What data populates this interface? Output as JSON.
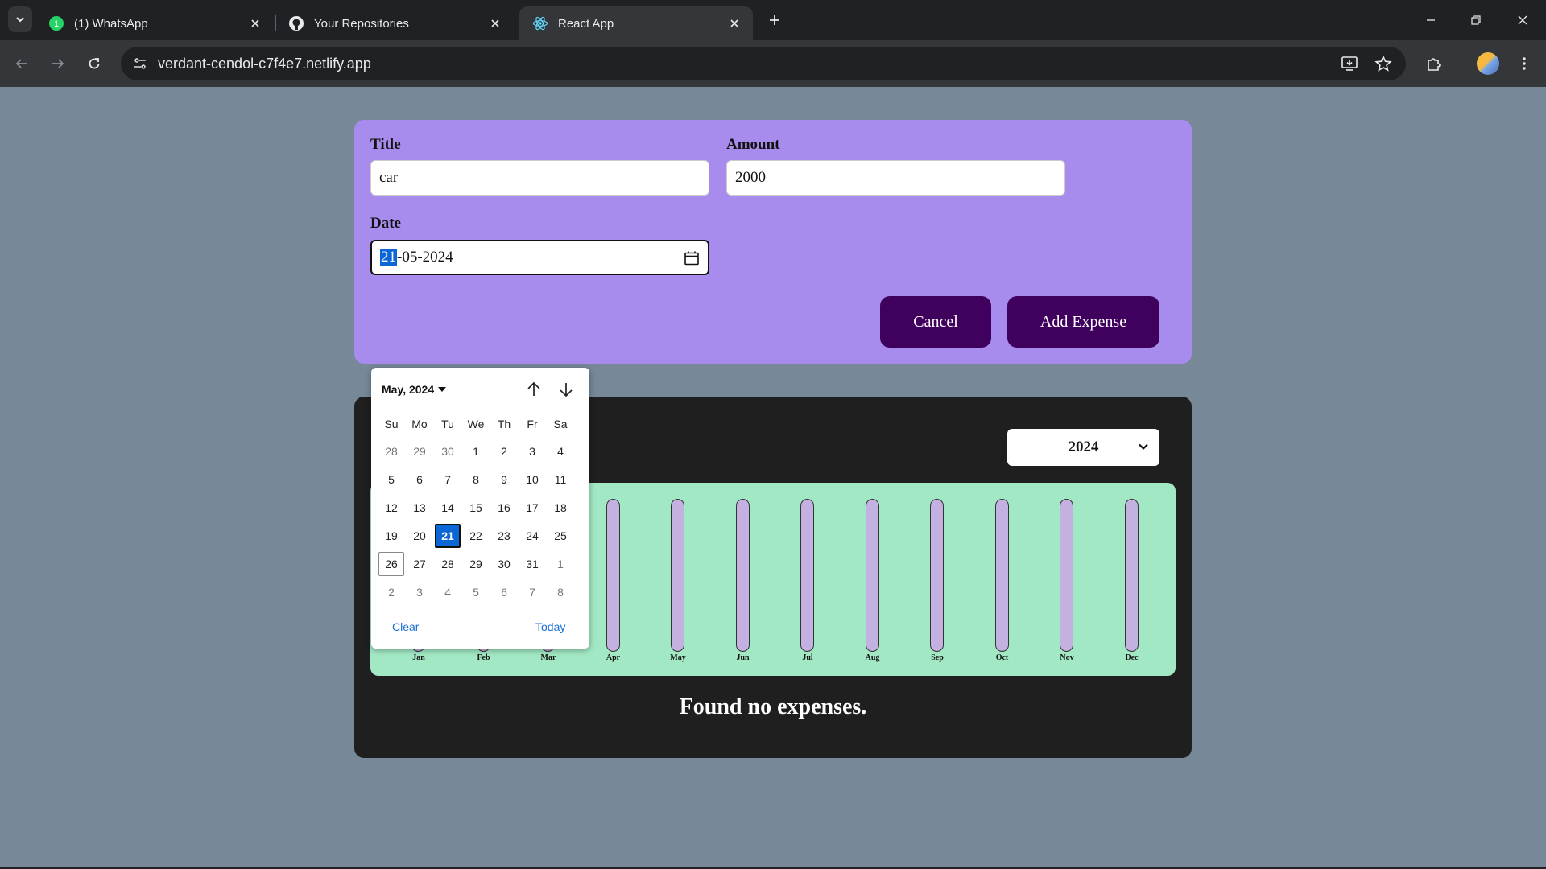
{
  "browser": {
    "tabs": [
      {
        "title": "(1) WhatsApp",
        "icon": "whatsapp-icon"
      },
      {
        "title": "Your Repositories",
        "icon": "github-icon"
      },
      {
        "title": "React App",
        "icon": "react-icon"
      }
    ],
    "url": "verdant-cendol-c7f4e7.netlify.app"
  },
  "form": {
    "title_label": "Title",
    "title_value": "car",
    "amount_label": "Amount",
    "amount_value": "2000",
    "date_label": "Date",
    "date_day": "21",
    "date_rest": "-05-2024",
    "cancel_label": "Cancel",
    "add_label": "Add Expense"
  },
  "datepicker": {
    "month_label": "May, 2024",
    "weekdays": [
      "Su",
      "Mo",
      "Tu",
      "We",
      "Th",
      "Fr",
      "Sa"
    ],
    "weeks": [
      [
        "28",
        "29",
        "30",
        "1",
        "2",
        "3",
        "4"
      ],
      [
        "5",
        "6",
        "7",
        "8",
        "9",
        "10",
        "11"
      ],
      [
        "12",
        "13",
        "14",
        "15",
        "16",
        "17",
        "18"
      ],
      [
        "19",
        "20",
        "21",
        "22",
        "23",
        "24",
        "25"
      ],
      [
        "26",
        "27",
        "28",
        "29",
        "30",
        "31",
        "1"
      ],
      [
        "2",
        "3",
        "4",
        "5",
        "6",
        "7",
        "8"
      ]
    ],
    "selected_day": "21",
    "today_day": "26",
    "clear_label": "Clear",
    "today_label": "Today"
  },
  "expenses": {
    "year_selected": "2024",
    "empty_message": "Found no expenses."
  },
  "chart_data": {
    "type": "bar",
    "categories": [
      "Jan",
      "Feb",
      "Mar",
      "Apr",
      "May",
      "Jun",
      "Jul",
      "Aug",
      "Sep",
      "Oct",
      "Nov",
      "Dec"
    ],
    "values": [
      0,
      0,
      0,
      0,
      0,
      0,
      0,
      0,
      0,
      0,
      0,
      0
    ]
  },
  "colors": {
    "page_bg": "#778899",
    "form_bg": "#a78bed",
    "button_bg": "#40005d",
    "chart_bg": "#a2e8c4",
    "bar_track": "#c3b1e1",
    "selected_day": "#0b66d6"
  }
}
